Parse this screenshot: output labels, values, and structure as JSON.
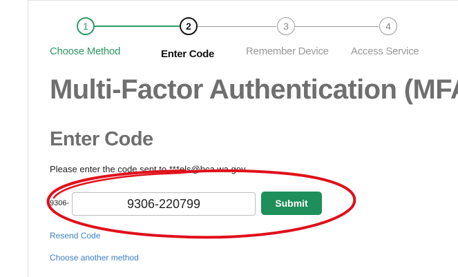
{
  "stepper": {
    "steps": [
      {
        "number": "1",
        "label": "Choose Method",
        "state": "done"
      },
      {
        "number": "2",
        "label": "Enter Code",
        "state": "active"
      },
      {
        "number": "3",
        "label": "Remember Device",
        "state": "pending"
      },
      {
        "number": "4",
        "label": "Access Service",
        "state": "pending"
      }
    ]
  },
  "page": {
    "title": "Multi-Factor Authentication (MFA)",
    "subtitle": "Enter Code",
    "instruction": "Please enter the code sent to ***els@hca.wa.gov"
  },
  "form": {
    "code_prefix": "9306-",
    "code_value": "9306-220799",
    "submit_label": "Submit"
  },
  "links": {
    "resend": "Resend Code",
    "choose_another": "Choose another method"
  },
  "colors": {
    "accent_green": "#1e8e5a",
    "step_done": "#2e9a62",
    "link_blue": "#3d7fc4",
    "annotation_red": "#e0101a"
  }
}
